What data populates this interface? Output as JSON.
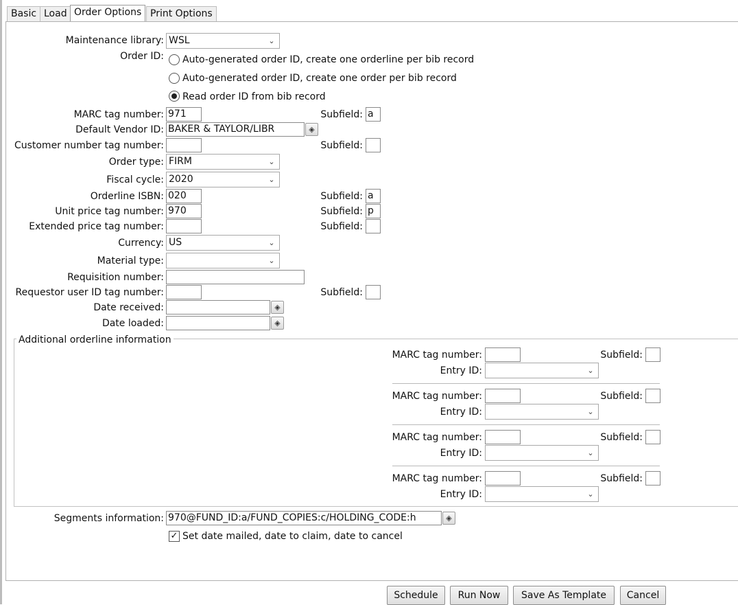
{
  "tabs": [
    "Basic",
    "Load",
    "Order Options",
    "Print Options"
  ],
  "form": {
    "maintenance_library": {
      "label": "Maintenance library:",
      "value": "WSL"
    },
    "order_id": {
      "label": "Order ID:",
      "options": [
        "Auto-generated order ID, create one orderline per bib record",
        "Auto-generated order ID, create one order per bib record",
        "Read order ID from bib record"
      ],
      "selected_index": 2
    },
    "marc_tag": {
      "label": "MARC tag number:",
      "value": "971",
      "subfield_label": "Subfield:",
      "subfield": "a"
    },
    "default_vendor": {
      "label": "Default Vendor ID:",
      "value": "BAKER & TAYLOR/LIBR"
    },
    "customer_number": {
      "label": "Customer number tag number:",
      "value": "",
      "subfield_label": "Subfield:",
      "subfield": ""
    },
    "order_type": {
      "label": "Order type:",
      "value": "FIRM"
    },
    "fiscal_cycle": {
      "label": "Fiscal cycle:",
      "value": "2020"
    },
    "orderline_isbn": {
      "label": "Orderline ISBN:",
      "value": "020",
      "subfield_label": "Subfield:",
      "subfield": "a"
    },
    "unit_price": {
      "label": "Unit price tag number:",
      "value": "970",
      "subfield_label": "Subfield:",
      "subfield": "p"
    },
    "extended_price": {
      "label": "Extended price tag number:",
      "value": "",
      "subfield_label": "Subfield:",
      "subfield": ""
    },
    "currency": {
      "label": "Currency:",
      "value": "US"
    },
    "material_type": {
      "label": "Material type:",
      "value": ""
    },
    "requisition_number": {
      "label": "Requisition number:",
      "value": ""
    },
    "requestor": {
      "label": "Requestor user ID tag number:",
      "value": "",
      "subfield_label": "Subfield:",
      "subfield": ""
    },
    "date_received": {
      "label": "Date received:",
      "value": ""
    },
    "date_loaded": {
      "label": "Date loaded:",
      "value": ""
    }
  },
  "additional": {
    "legend": "Additional orderline information",
    "marc_label": "MARC tag number:",
    "subfield_label": "Subfield:",
    "entry_label": "Entry ID:",
    "rows": [
      {
        "marc": "",
        "subfield": "",
        "entry": ""
      },
      {
        "marc": "",
        "subfield": "",
        "entry": ""
      },
      {
        "marc": "",
        "subfield": "",
        "entry": ""
      },
      {
        "marc": "",
        "subfield": "",
        "entry": ""
      }
    ]
  },
  "segments": {
    "label": "Segments information:",
    "value": "970@FUND_ID:a/FUND_COPIES:c/HOLDING_CODE:h"
  },
  "set_dates": {
    "label": "Set date mailed, date to claim, date to cancel",
    "checked": true
  },
  "buttons": {
    "schedule": "Schedule",
    "run_now": "Run Now",
    "save_template": "Save As Template",
    "cancel": "Cancel"
  }
}
